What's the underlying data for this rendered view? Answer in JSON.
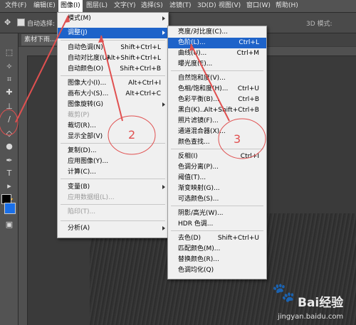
{
  "menubar": {
    "items": [
      "文件(F)",
      "编辑(E)",
      "图像(I)",
      "图层(L)",
      "文字(Y)",
      "选择(S)",
      "滤镜(T)",
      "3D(D)",
      "视图(V)",
      "窗口(W)",
      "帮助(H)"
    ]
  },
  "options_bar": {
    "auto_select_label": "自动选择:",
    "mode_label": "3D 模式:"
  },
  "document_tab": {
    "title": "素材下雨..."
  },
  "image_menu": {
    "items": [
      {
        "label": "模式(M)",
        "shortcut": "",
        "submenu": true
      },
      {
        "label": "调整(J)",
        "shortcut": "",
        "submenu": true,
        "highlighted": true
      },
      {
        "label": "自动色调(N)",
        "shortcut": "Shift+Ctrl+L"
      },
      {
        "label": "自动对比度(U)",
        "shortcut": "Alt+Shift+Ctrl+L"
      },
      {
        "label": "自动颜色(O)",
        "shortcut": "Shift+Ctrl+B"
      },
      {
        "label": "图像大小(I)...",
        "shortcut": "Alt+Ctrl+I"
      },
      {
        "label": "画布大小(S)...",
        "shortcut": "Alt+Ctrl+C"
      },
      {
        "label": "图像旋转(G)",
        "shortcut": "",
        "submenu": true
      },
      {
        "label": "裁剪(P)",
        "shortcut": "",
        "disabled": true
      },
      {
        "label": "裁切(R)...",
        "shortcut": ""
      },
      {
        "label": "显示全部(V)",
        "shortcut": ""
      },
      {
        "label": "复制(D)...",
        "shortcut": ""
      },
      {
        "label": "应用图像(Y)...",
        "shortcut": ""
      },
      {
        "label": "计算(C)...",
        "shortcut": ""
      },
      {
        "label": "变量(B)",
        "shortcut": "",
        "submenu": true
      },
      {
        "label": "应用数据组(L)...",
        "shortcut": "",
        "disabled": true
      },
      {
        "label": "陷印(T)...",
        "shortcut": "",
        "disabled": true
      },
      {
        "label": "分析(A)",
        "shortcut": "",
        "submenu": true
      }
    ]
  },
  "adjust_menu": {
    "items": [
      {
        "label": "亮度/对比度(C)...",
        "shortcut": ""
      },
      {
        "label": "色阶(L)...",
        "shortcut": "Ctrl+L",
        "highlighted": true
      },
      {
        "label": "曲线(U)...",
        "shortcut": "Ctrl+M"
      },
      {
        "label": "曝光度(E)...",
        "shortcut": ""
      },
      {
        "label": "自然饱和度(V)...",
        "shortcut": ""
      },
      {
        "label": "色相/饱和度(H)...",
        "shortcut": "Ctrl+U"
      },
      {
        "label": "色彩平衡(B)...",
        "shortcut": "Ctrl+B"
      },
      {
        "label": "黑白(K)...",
        "shortcut": "Alt+Shift+Ctrl+B"
      },
      {
        "label": "照片滤镜(F)...",
        "shortcut": ""
      },
      {
        "label": "通道混合器(X)...",
        "shortcut": ""
      },
      {
        "label": "颜色查找...",
        "shortcut": ""
      },
      {
        "label": "反相(I)",
        "shortcut": "Ctrl+I"
      },
      {
        "label": "色调分离(P)...",
        "shortcut": ""
      },
      {
        "label": "阈值(T)...",
        "shortcut": ""
      },
      {
        "label": "渐变映射(G)...",
        "shortcut": ""
      },
      {
        "label": "可选颜色(S)...",
        "shortcut": ""
      },
      {
        "label": "阴影/高光(W)...",
        "shortcut": ""
      },
      {
        "label": "HDR 色调...",
        "shortcut": ""
      },
      {
        "label": "去色(D)",
        "shortcut": "Shift+Ctrl+U"
      },
      {
        "label": "匹配颜色(M)...",
        "shortcut": ""
      },
      {
        "label": "替换颜色(R)...",
        "shortcut": ""
      },
      {
        "label": "色调均化(Q)",
        "shortcut": ""
      }
    ]
  },
  "annotations": {
    "step2": "2",
    "step3": "3"
  },
  "watermark": {
    "brand": "Bai经验",
    "url": "jingyan.baidu.com"
  },
  "colors": {
    "accent": "#1e63c9",
    "annotation": "#e05050",
    "foreground_swatch": "#000000",
    "background_swatch": "#1a6fe8"
  }
}
